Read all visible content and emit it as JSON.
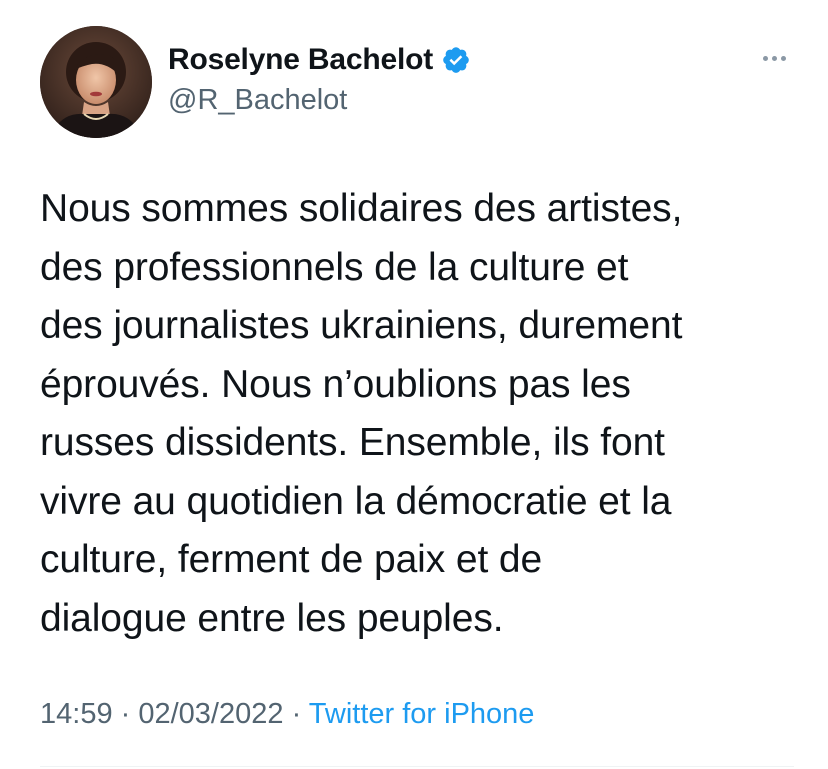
{
  "author": {
    "display_name": "Roselyne Bachelot",
    "handle": "@R_Bachelot",
    "verified": true
  },
  "tweet": {
    "lines": [
      "Nous sommes solidaires des artistes,",
      "des professionnels de la culture et",
      "des journalistes ukrainiens, durement",
      "éprouvés. Nous n’oublions pas les",
      "russes dissidents. Ensemble, ils font",
      "vivre au quotidien la démocratie et la",
      "culture, ferment de paix et de",
      "dialogue entre les peuples."
    ],
    "time": "14:59",
    "separator": " · ",
    "date": "02/03/2022",
    "source": "Twitter for iPhone"
  },
  "icons": {
    "verified": "verified-badge-icon",
    "more": "more-options-icon"
  },
  "colors": {
    "text": "#0f1419",
    "secondary": "#536471",
    "link": "#1d9bf0",
    "verified": "#1d9bf0"
  }
}
